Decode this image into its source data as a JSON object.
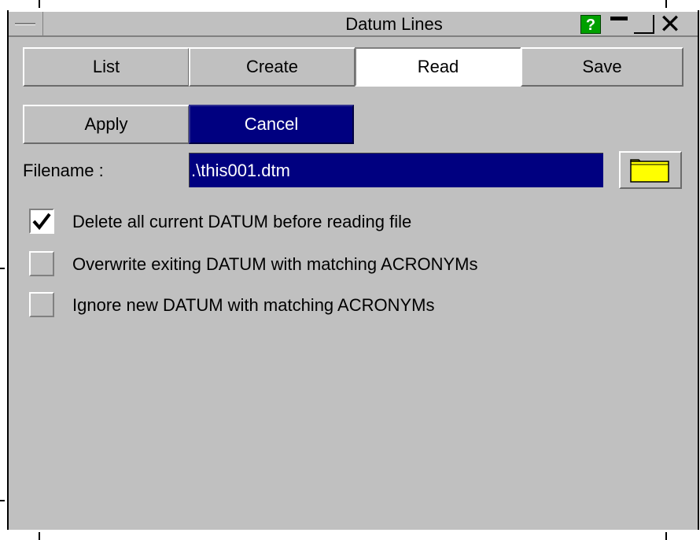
{
  "window": {
    "title": "Datum Lines",
    "help_label": "?"
  },
  "tabs": [
    {
      "label": "List",
      "active": false
    },
    {
      "label": "Create",
      "active": false
    },
    {
      "label": "Read",
      "active": true
    },
    {
      "label": "Save",
      "active": false
    }
  ],
  "actions": {
    "apply_label": "Apply",
    "cancel_label": "Cancel"
  },
  "file": {
    "label": "Filename :",
    "value": ".\\this001.dtm",
    "browse_icon": "folder-icon"
  },
  "options": [
    {
      "label": "Delete all current DATUM before reading file",
      "checked": true
    },
    {
      "label": "Overwrite exiting DATUM with matching ACRONYMs",
      "checked": false
    },
    {
      "label": "Ignore new DATUM with matching ACRONYMs",
      "checked": false
    }
  ],
  "colors": {
    "panel": "#c0c0c0",
    "selection": "#000080",
    "help": "#00a000",
    "folder": "#ffff00"
  }
}
